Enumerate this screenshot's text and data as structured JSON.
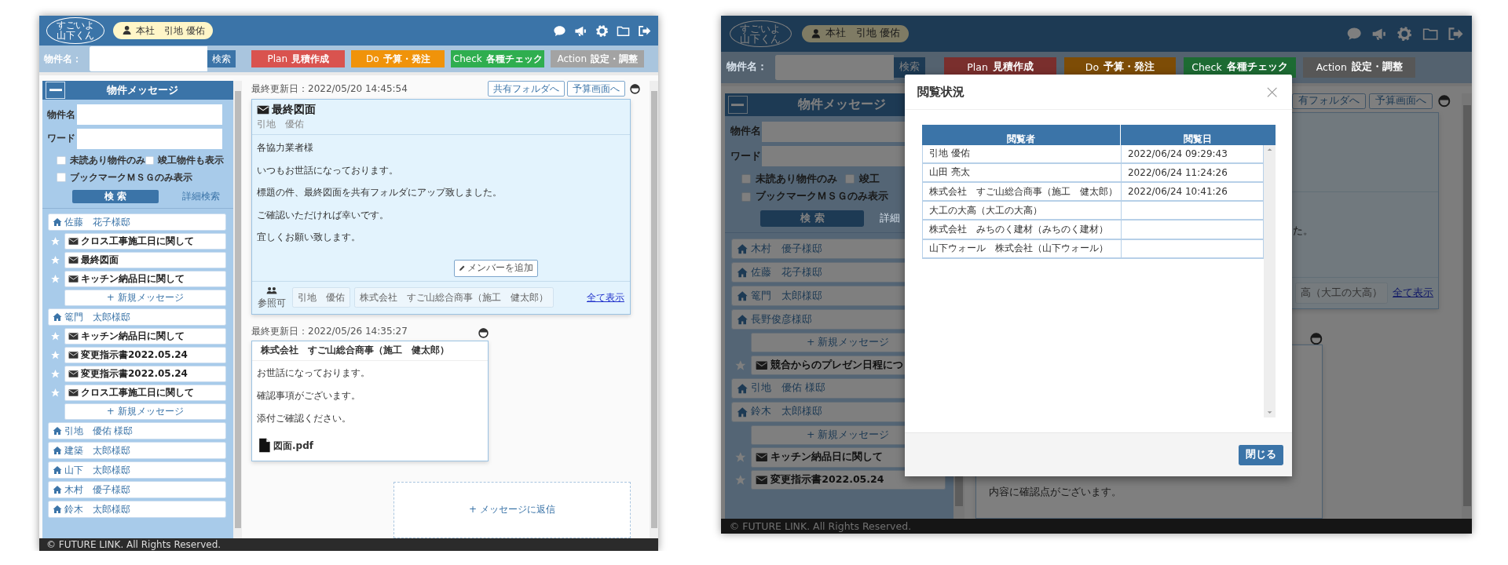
{
  "screens": [
    {
      "kind": "main",
      "header": {
        "logo_top": "すごいよ",
        "logo_bottom": "山下くん",
        "user": "本社　引地 優佑"
      },
      "search": {
        "label": "物件名：",
        "button": "検索"
      },
      "phases": [
        {
          "name": "Plan",
          "label": "見積作成",
          "color": "#d9534f"
        },
        {
          "name": "Do",
          "label": "予算・発注",
          "color": "#f0930a"
        },
        {
          "name": "Check",
          "label": "各種チェック",
          "color": "#2fae4f"
        },
        {
          "name": "Action",
          "label": "設定・調整",
          "color": "#a3a3a3"
        }
      ],
      "sidebar": {
        "title": "物件メッセージ",
        "fields": [
          {
            "label": "物件名"
          },
          {
            "label": "ワード"
          }
        ],
        "filters": [
          {
            "label": "未読あり物件のみ",
            "checked": false
          },
          {
            "label": "竣工物件も表示",
            "checked": false
          },
          {
            "label": "ブックマークＭＳＧのみ表示",
            "checked": false
          }
        ],
        "search_button": "検 索",
        "detail_link": "詳細検索",
        "properties": [
          {
            "name": "佐藤　花子様邸",
            "children": [
              {
                "kind": "message",
                "title": "クロス工事施工日に関して"
              },
              {
                "kind": "message",
                "title": "最終図面"
              },
              {
                "kind": "message",
                "title": "キッチン納品日に関して"
              },
              {
                "kind": "new",
                "label": "+ 新規メッセージ"
              }
            ]
          },
          {
            "name": "篭門　太郎様邸",
            "children": [
              {
                "kind": "message",
                "title": "キッチン納品日に関して"
              },
              {
                "kind": "message",
                "title": "変更指示書2022.05.24"
              },
              {
                "kind": "message",
                "title": "変更指示書2022.05.24"
              },
              {
                "kind": "message",
                "title": "クロス工事施工日に関して"
              },
              {
                "kind": "new",
                "label": "+ 新規メッセージ"
              }
            ]
          },
          {
            "name": "引地　優佑 様邸"
          },
          {
            "name": "建築　太郎様邸"
          },
          {
            "name": "山下　太郎様邸"
          },
          {
            "name": "木村　優子様邸"
          },
          {
            "name": "鈴木　太郎様邸"
          }
        ]
      },
      "toolbar": {
        "buttons": [
          "共有フォルダへ",
          "予算画面へ"
        ]
      },
      "messages": [
        {
          "kind": "note",
          "updated": "最終更新日：2022/05/20 14:45:54",
          "title": "最終図面",
          "author": "引地　優佑",
          "body": [
            "各協力業者様",
            "いつもお世話になっております。",
            "標題の件、最終図面を共有フォルダにアップ致しました。",
            "ご確認いただければ幸いです。",
            "宜しくお願い致します。"
          ],
          "add_member": "メンバーを追加",
          "access_label": "参照可",
          "members": [
            "引地　優佑",
            "株式会社　すご山総合商事（施工　健太郎）"
          ],
          "show_all": "全て表示"
        },
        {
          "kind": "reply",
          "updated": "最終更新日：2022/05/26 14:35:27",
          "sender": "株式会社　すご山総合商事（施工　健太郎）",
          "body": [
            "お世話になっております。",
            "確認事項がございます。",
            "添付ご確認ください。"
          ],
          "attachment": "図面.pdf"
        }
      ],
      "reply": "+ メッセージに返信",
      "footer": "© FUTURE LINK. All Rights Reserved."
    },
    {
      "kind": "dialog",
      "header": {
        "logo_top": "すごいよ",
        "logo_bottom": "山下くん",
        "user": "本社　引地 優佑"
      },
      "search": {
        "label": "物件名：",
        "button": "検索"
      },
      "phases": [
        {
          "name": "Plan",
          "label": "見積作成",
          "color": "#7a2f2d"
        },
        {
          "name": "Do",
          "label": "予算・発注",
          "color": "#7d4c06"
        },
        {
          "name": "Check",
          "label": "各種チェック",
          "color": "#1d6b33"
        },
        {
          "name": "Action",
          "label": "設定・調整",
          "color": "#575757"
        }
      ],
      "sidebar": {
        "title": "物件メッセージ",
        "fields": [
          {
            "label": "物件名"
          },
          {
            "label": "ワード"
          }
        ],
        "filters": [
          {
            "label": "未読あり物件のみ",
            "checked": false
          },
          {
            "label": "竣工",
            "checked": false
          },
          {
            "label": "ブックマークＭＳＧのみ表示",
            "checked": false
          }
        ],
        "search_button": "検 索",
        "detail_link": "詳細",
        "properties": [
          {
            "name": "木村　優子様邸"
          },
          {
            "name": "佐藤　花子様邸"
          },
          {
            "name": "篭門　太郎様邸"
          },
          {
            "name": "長野俊彦様邸",
            "children": [
              {
                "kind": "new",
                "label": "+ 新規メッセージ"
              },
              {
                "kind": "message",
                "title": "競合からのプレゼン日程につ"
              }
            ]
          },
          {
            "name": "引地　優佑 様邸"
          },
          {
            "name": "鈴木　太郎様邸",
            "children": [
              {
                "kind": "new",
                "label": "+ 新規メッセージ"
              },
              {
                "kind": "message",
                "title": "キッチン納品日に関して"
              },
              {
                "kind": "message",
                "title": "変更指示書2022.05.24"
              }
            ]
          }
        ]
      },
      "toolbar": {
        "buttons": [
          "有フォルダへ",
          "予算画面へ"
        ]
      },
      "messages": [
        {
          "kind": "note_partial",
          "body": [
            "た。"
          ],
          "members": [
            "高（大工の大高）"
          ],
          "show_all": "全て表示"
        },
        {
          "kind": "reply_partial",
          "body": [
            "内容に確認点がございます。"
          ]
        }
      ],
      "footer": "© FUTURE LINK. All Rights Reserved.",
      "modal": {
        "title": "閲覧状況",
        "columns": [
          "閲覧者",
          "閲覧日"
        ],
        "rows": [
          {
            "viewer": "引地 優佑",
            "date": "2022/06/24 09:29:43"
          },
          {
            "viewer": "山田 亮太",
            "date": "2022/06/24 11:24:26"
          },
          {
            "viewer": "株式会社　すご山総合商事（施工　健太郎）",
            "date": "2022/06/24 10:41:26"
          },
          {
            "viewer": "大工の大高（大工の大高）"
          },
          {
            "viewer": "株式会社　みちのく建材（みちのく建材）"
          },
          {
            "viewer": "山下ウォール　株式会社（山下ウォール）"
          }
        ],
        "close_button": "閉じる"
      }
    }
  ]
}
